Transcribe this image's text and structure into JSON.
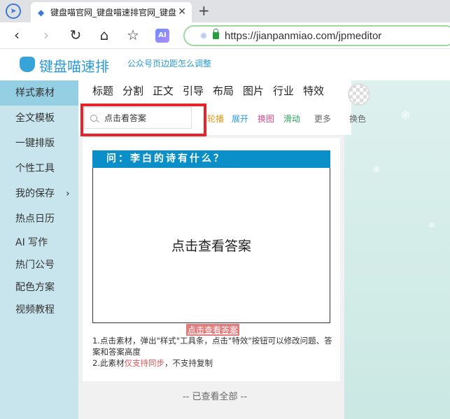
{
  "browser": {
    "tab_title": "键盘喵官网_键盘喵速排官网_键盘",
    "tab_close": "✕",
    "new_tab": "+",
    "url": "https://jianpanmiao.com/jpmeditor",
    "ext_label": "AI",
    "icons": {
      "back": "‹",
      "forward": "›",
      "reload": "↻",
      "home": "⌂",
      "star": "☆"
    }
  },
  "site": {
    "logo_text": "键盘喵速排",
    "header_link": "公众号页边距怎么调整"
  },
  "sidebar": {
    "items": [
      {
        "label": "样式素材",
        "active": true
      },
      {
        "label": "全文模板"
      },
      {
        "label": "一键排版"
      },
      {
        "label": "个性工具"
      },
      {
        "label": "我的保存",
        "arrow": "›"
      },
      {
        "label": "热点日历"
      },
      {
        "label": "AI 写作"
      },
      {
        "label": "热门公号"
      },
      {
        "label": "配色方案"
      },
      {
        "label": "视频教程"
      }
    ]
  },
  "categories": [
    "标题",
    "分割",
    "正文",
    "引导",
    "布局",
    "图片",
    "行业",
    "特效"
  ],
  "swatch_label": "换色",
  "search": {
    "query": "点击看答案"
  },
  "effects": {
    "lunbo": {
      "label": "轮播",
      "color": "#e69a1c"
    },
    "zhankai": {
      "label": "展开",
      "color": "#2a9ad6"
    },
    "huantu": {
      "label": "换图",
      "color": "#d94b8b"
    },
    "huadong": {
      "label": "滑动",
      "color": "#2aa15a"
    },
    "more": {
      "label": "更多"
    }
  },
  "card": {
    "question": "问：李白的诗有什么？",
    "body_text": "点击查看答案",
    "reveal_button": "点击查看答案",
    "note1": "1.点击素材，弹出\"样式\"工具条，点击\"特效\"按钮可以修改问题、答案和答案高度",
    "note2_prefix": "2.此素材",
    "note2_red": "仅支持同步",
    "note2_suffix": "，不支持复制"
  },
  "footer": "-- 已查看全部 --",
  "colors": {
    "accent": "#2a9ad6",
    "question_header": "#0a8fc9",
    "highlight": "#e6242b",
    "sidebar_bg": "#c8e5ee"
  }
}
